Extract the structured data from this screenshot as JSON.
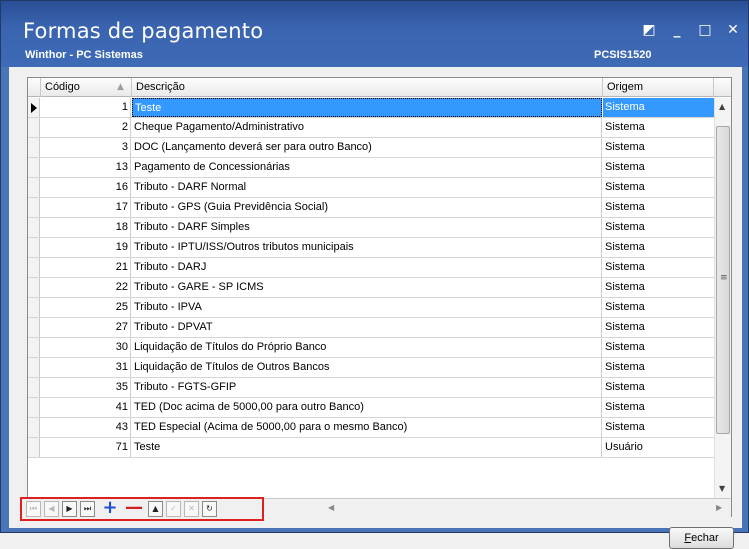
{
  "window": {
    "title": "Formas de pagamento",
    "subtitle": "Winthor - PC Sistemas",
    "code": "PCSIS1520",
    "controls": {
      "restore": "◩",
      "minimize": "_",
      "maximize": "□",
      "close": "✕"
    }
  },
  "grid": {
    "columns": [
      "Código",
      "Descrição",
      "Origem"
    ],
    "sort_icon": "▲",
    "rows": [
      {
        "code": "1",
        "desc": "Teste",
        "origin": "Sistema",
        "selected": true
      },
      {
        "code": "2",
        "desc": "Cheque Pagamento/Administrativo",
        "origin": "Sistema"
      },
      {
        "code": "3",
        "desc": "DOC (Lançamento deverá ser para outro Banco)",
        "origin": "Sistema"
      },
      {
        "code": "13",
        "desc": "Pagamento de Concessionárias",
        "origin": "Sistema"
      },
      {
        "code": "16",
        "desc": "Tributo - DARF Normal",
        "origin": "Sistema"
      },
      {
        "code": "17",
        "desc": "Tributo - GPS (Guia Previdência Social)",
        "origin": "Sistema"
      },
      {
        "code": "18",
        "desc": "Tributo - DARF Simples",
        "origin": "Sistema"
      },
      {
        "code": "19",
        "desc": "Tributo - IPTU/ISS/Outros tributos municipais",
        "origin": "Sistema"
      },
      {
        "code": "21",
        "desc": "Tributo - DARJ",
        "origin": "Sistema"
      },
      {
        "code": "22",
        "desc": "Tributo - GARE - SP ICMS",
        "origin": "Sistema"
      },
      {
        "code": "25",
        "desc": "Tributo - IPVA",
        "origin": "Sistema"
      },
      {
        "code": "27",
        "desc": "Tributo - DPVAT",
        "origin": "Sistema"
      },
      {
        "code": "30",
        "desc": "Liquidação de Títulos do Próprio Banco",
        "origin": "Sistema"
      },
      {
        "code": "31",
        "desc": "Liquidação de Títulos de Outros Bancos",
        "origin": "Sistema"
      },
      {
        "code": "35",
        "desc": "Tributo - FGTS-GFIP",
        "origin": "Sistema"
      },
      {
        "code": "41",
        "desc": "TED (Doc acima de 5000,00 para outro Banco)",
        "origin": "Sistema"
      },
      {
        "code": "43",
        "desc": "TED Especial (Acima de 5000,00 para o mesmo Banco)",
        "origin": "Sistema"
      },
      {
        "code": "71",
        "desc": "Teste",
        "origin": "Usuário"
      }
    ]
  },
  "navigator": {
    "first": "⏮",
    "prior": "◀",
    "next": "▶",
    "last": "⏭",
    "insert": "+",
    "delete": "—",
    "edit": "▲",
    "post": "✓",
    "cancel": "✕",
    "refresh": "↻"
  },
  "buttons": {
    "close_prefix": "",
    "close_access": "F",
    "close_rest": "echar"
  }
}
